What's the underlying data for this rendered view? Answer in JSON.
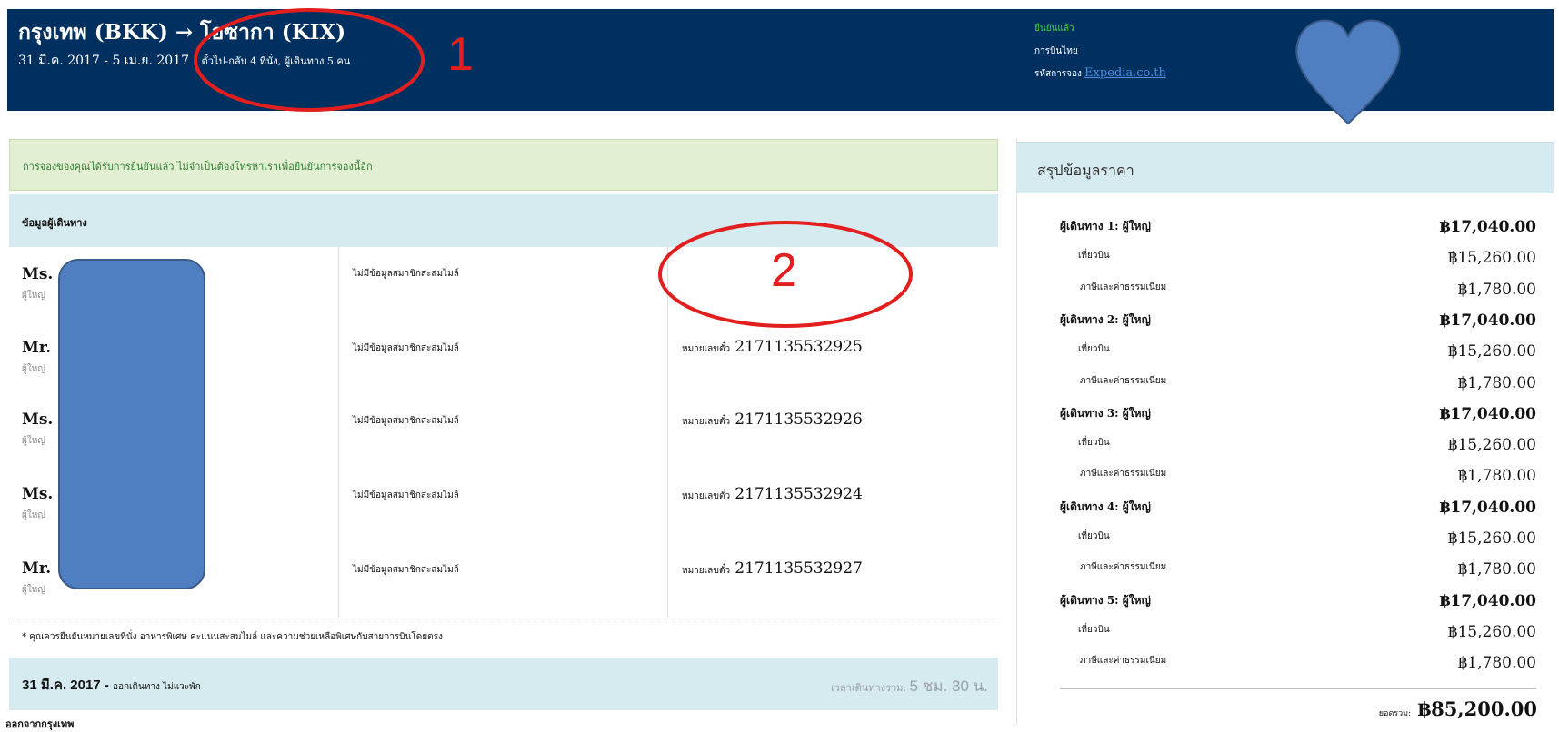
{
  "header": {
    "route": "กรุงเทพ (BKK) → โอซากา (KIX)",
    "dates": "31 มี.ค. 2017 - 5 เม.ย. 2017 |",
    "trip_info": "ตั๋วไป-กลับ 4 ที่นั่ง, ผู้เดินทาง 5 คน",
    "status": "ยืนยันแล้ว",
    "airline": "การบินไทย",
    "booking_label": "รหัสการจอง",
    "booking_link": "Expedia.co.th"
  },
  "confirmation_message": "การจองของคุณได้รับการยืนยันแล้ว ไม่จำเป็นต้องโทรหาเราเพื่อยืนยันการจองนี้อีก",
  "travelers_title": "ข้อมูลผู้เดินทาง",
  "travelers": [
    {
      "name": "Ms.",
      "type": "ผู้ใหญ่",
      "miles": "ไม่มีข้อมูลสมาชิกสะสมไมล์",
      "ticket_label": "",
      "ticket": ""
    },
    {
      "name": "Mr.",
      "type": "ผู้ใหญ่",
      "miles": "ไม่มีข้อมูลสมาชิกสะสมไมล์",
      "ticket_label": "หมายเลขตั๋ว",
      "ticket": "2171135532925"
    },
    {
      "name": "Ms.                        nda",
      "type": "ผู้ใหญ่",
      "miles": "ไม่มีข้อมูลสมาชิกสะสมไมล์",
      "ticket_label": "หมายเลขตั๋ว",
      "ticket": "2171135532926"
    },
    {
      "name": "Ms.",
      "type": "ผู้ใหญ่",
      "miles": "ไม่มีข้อมูลสมาชิกสะสมไมล์",
      "ticket_label": "หมายเลขตั๋ว",
      "ticket": "2171135532924"
    },
    {
      "name": "Mr.",
      "type": "ผู้ใหญ่",
      "miles": "ไม่มีข้อมูลสมาชิกสะสมไมล์",
      "ticket_label": "หมายเลขตั๋ว",
      "ticket": "2171135532927"
    }
  ],
  "note": "* คุณควรยืนยันหมายเลขที่นั่ง อาหารพิเศษ คะแนนสะสมไมล์ และความช่วยเหลือพิเศษกับสายการบินโดยตรง",
  "flight": {
    "date": "31 มี.ค. 2017 -",
    "label": "ออกเดินทาง ไม่แวะพัก",
    "duration_label": "เวลาเดินทางรวม:",
    "duration": "5 ชม. 30 น.",
    "next_line": "ออกจากกรุงเทพ"
  },
  "summary": {
    "title": "สรุปข้อมูลราคา",
    "rows": [
      {
        "level": 1,
        "label": "ผู้เดินทาง 1: ผู้ใหญ่",
        "amount": "฿17,040.00"
      },
      {
        "level": 2,
        "label": "เที่ยวบิน",
        "amount": "฿15,260.00"
      },
      {
        "level": 3,
        "label": "ภาษีและค่าธรรมเนียม",
        "amount": "฿1,780.00"
      },
      {
        "level": 1,
        "label": "ผู้เดินทาง 2: ผู้ใหญ่",
        "amount": "฿17,040.00"
      },
      {
        "level": 2,
        "label": "เที่ยวบิน",
        "amount": "฿15,260.00"
      },
      {
        "level": 3,
        "label": "ภาษีและค่าธรรมเนียม",
        "amount": "฿1,780.00"
      },
      {
        "level": 1,
        "label": "ผู้เดินทาง 3: ผู้ใหญ่",
        "amount": "฿17,040.00"
      },
      {
        "level": 2,
        "label": "เที่ยวบิน",
        "amount": "฿15,260.00"
      },
      {
        "level": 3,
        "label": "ภาษีและค่าธรรมเนียม",
        "amount": "฿1,780.00"
      },
      {
        "level": 1,
        "label": "ผู้เดินทาง 4: ผู้ใหญ่",
        "amount": "฿17,040.00"
      },
      {
        "level": 2,
        "label": "เที่ยวบิน",
        "amount": "฿15,260.00"
      },
      {
        "level": 3,
        "label": "ภาษีและค่าธรรมเนียม",
        "amount": "฿1,780.00"
      },
      {
        "level": 1,
        "label": "ผู้เดินทาง 5: ผู้ใหญ่",
        "amount": "฿17,040.00"
      },
      {
        "level": 2,
        "label": "เที่ยวบิน",
        "amount": "฿15,260.00"
      },
      {
        "level": 3,
        "label": "ภาษีและค่าธรรมเนียม",
        "amount": "฿1,780.00"
      }
    ],
    "total_label": "ยอดรวม:",
    "total": "฿85,200.00"
  },
  "annotations": {
    "marker1": "1",
    "marker2": "2",
    "ellipse_color": "#e31e1e",
    "heart_color": "#4f7fc0",
    "redaction_color": "#4f7fc0"
  },
  "colors": {
    "header_bg": "#00305f",
    "confirm_bg": "#e3efd2",
    "section_bg": "#d6ebf0",
    "status_green": "#3ecf3e"
  }
}
